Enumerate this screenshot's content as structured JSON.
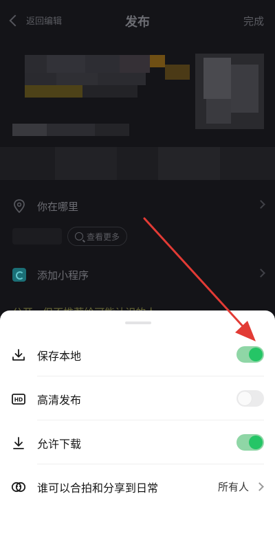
{
  "header": {
    "back_label": "返回编辑",
    "title": "发布",
    "done_label": "完成"
  },
  "dark_list": {
    "location_label": "你在哪里",
    "more_label": "查看更多",
    "mini_program_label": "添加小程序",
    "public_label": "公开 · 但不推荐给可能认识的人"
  },
  "sheet": {
    "save_local_label": "保存本地",
    "save_local_on": true,
    "hd_label": "高清发布",
    "hd_on": false,
    "allow_download_label": "允许下载",
    "allow_download_on": true,
    "who_label": "谁可以合拍和分享到日常",
    "who_value": "所有人"
  },
  "colors": {
    "toggle_on": "#25c566",
    "toggle_on_track": "#8fd6a6",
    "toggle_off_track": "#ebebec",
    "annotation_arrow": "#e23b35"
  },
  "icons": [
    "back-chevron-icon",
    "location-pin-icon",
    "search-icon",
    "mini-program-icon",
    "download-icon",
    "hd-icon",
    "duet-icon",
    "chevron-right-icon"
  ]
}
